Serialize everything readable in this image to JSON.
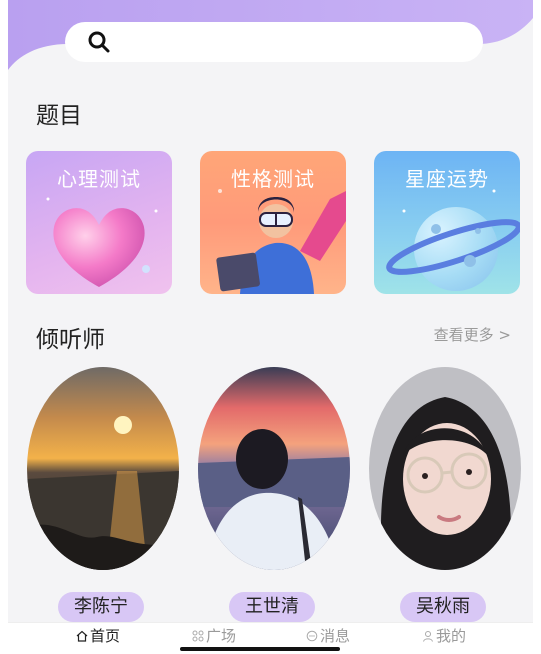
{
  "search": {
    "placeholder": ""
  },
  "sections": {
    "topics_title": "题目",
    "counselors_title": "倾听师",
    "see_more": "查看更多 >"
  },
  "topics": [
    {
      "label": "心理测试",
      "icon": "heart-illustration"
    },
    {
      "label": "性格测试",
      "icon": "person-vr-illustration"
    },
    {
      "label": "星座运势",
      "icon": "planet-illustration"
    }
  ],
  "counselors": [
    {
      "name": "李陈宁",
      "avatar": "sunset-sea-photo"
    },
    {
      "name": "王世清",
      "avatar": "man-at-sea-photo"
    },
    {
      "name": "吴秋雨",
      "avatar": "girl-glasses-photo"
    }
  ],
  "tabs": [
    {
      "label": "首页",
      "icon": "home-icon",
      "active": true
    },
    {
      "label": "广场",
      "icon": "grid-icon",
      "active": false
    },
    {
      "label": "消息",
      "icon": "chat-icon",
      "active": false
    },
    {
      "label": "我的",
      "icon": "user-icon",
      "active": false
    }
  ],
  "colors": {
    "accent": "#b79cf0",
    "pill": "#d8c7f5",
    "background": "#f4f4f6"
  }
}
